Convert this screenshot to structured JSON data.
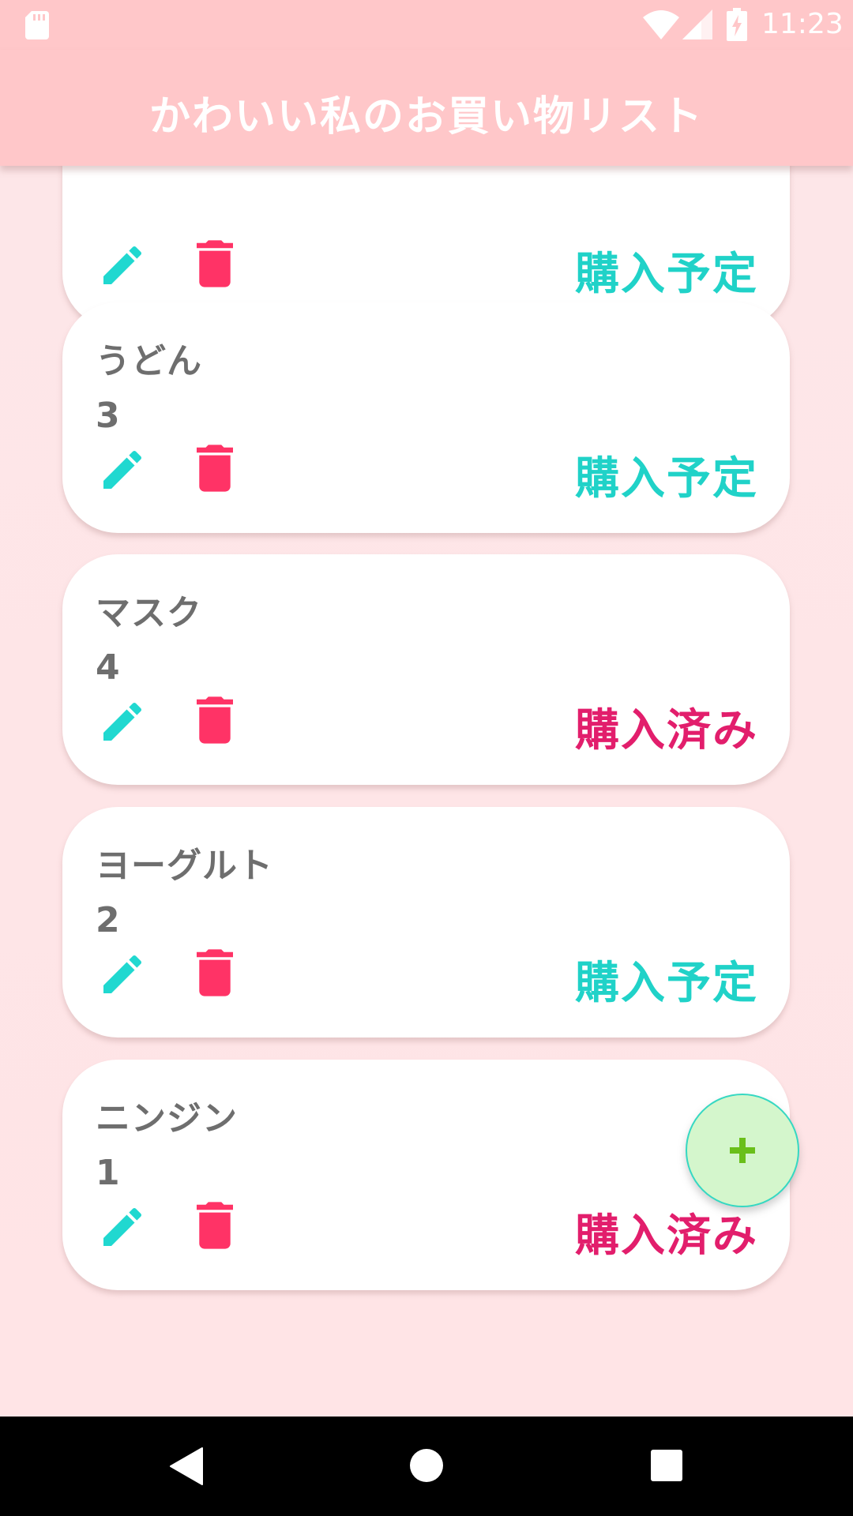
{
  "status_bar": {
    "time": "11:23",
    "icons": [
      "sd-card-icon",
      "wifi-icon",
      "cell-signal-icon",
      "battery-charging-icon"
    ]
  },
  "app_bar": {
    "title": "かわいい私のお買い物リスト"
  },
  "colors": {
    "bar": "#ffc7c9",
    "background": "#fde6e8",
    "planned": "#20d2c8",
    "done": "#e21e6c",
    "delete": "#ff3366",
    "edit": "#20d8d0",
    "fab": "#d4f6cc",
    "fab_plus": "#6abf1a"
  },
  "items": [
    {
      "name": "",
      "quantity": "",
      "status": "購入予定",
      "status_type": "planned"
    },
    {
      "name": "うどん",
      "quantity": "3",
      "status": "購入予定",
      "status_type": "planned"
    },
    {
      "name": "マスク",
      "quantity": "4",
      "status": "購入済み",
      "status_type": "done"
    },
    {
      "name": "ヨーグルト",
      "quantity": "2",
      "status": "購入予定",
      "status_type": "planned"
    },
    {
      "name": "ニンジン",
      "quantity": "1",
      "status": "購入済み",
      "status_type": "done"
    }
  ],
  "fab": {
    "icon": "plus-icon"
  },
  "nav_bar": {
    "icons": [
      "back-icon",
      "home-icon",
      "recent-apps-icon"
    ]
  }
}
